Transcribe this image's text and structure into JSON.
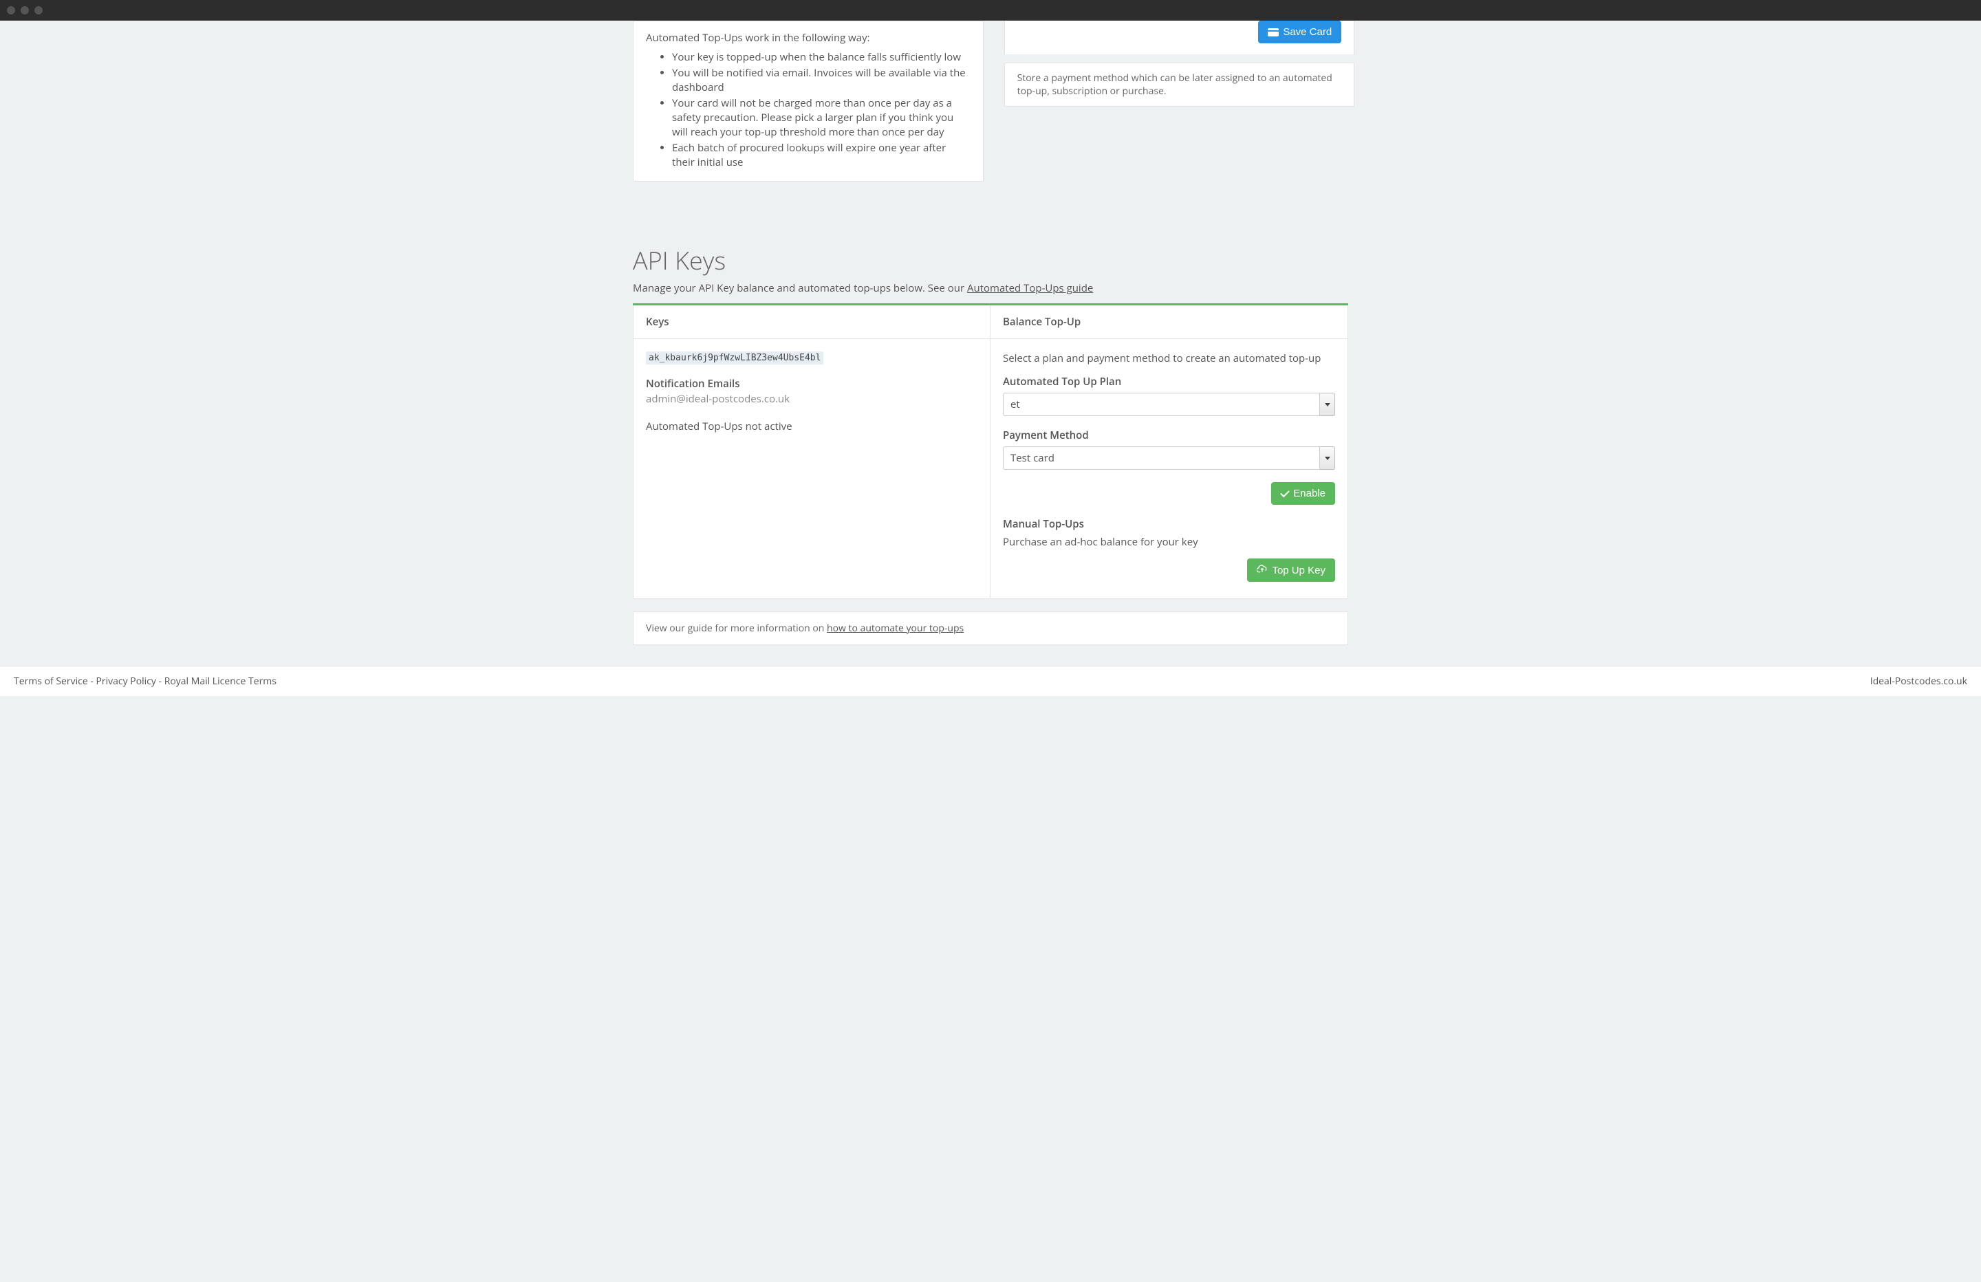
{
  "titlebar": {
    "dots": 3
  },
  "topups_info": {
    "intro": "Automated Top-Ups work in the following way:",
    "bullets": [
      "Your key is topped-up when the balance falls sufficiently low",
      "You will be notified via email. Invoices will be available via the dashboard",
      "Your card will not be charged more than once per day as a safety precaution. Please pick a larger plan if you think you will reach your top-up threshold more than once per day",
      "Each batch of procured lookups will expire one year after their initial use"
    ]
  },
  "save_card": {
    "button": "Save Card"
  },
  "store_note": "Store a payment method which can be later assigned to an automated top-up, subscription or purchase.",
  "api_keys": {
    "title": "API Keys",
    "subtitle_prefix": "Manage your API Key balance and automated top-ups below. See our ",
    "subtitle_link": "Automated Top-Ups guide",
    "col_keys_header": "Keys",
    "col_balance_header": "Balance Top-Up",
    "key_value": "ak_kbaurk6j9pfWzwLIBZ3ew4UbsE4bl",
    "notif_heading": "Notification Emails",
    "notif_email": "admin@ideal-postcodes.co.uk",
    "topup_status": "Automated Top-Ups not active",
    "right_desc": "Select a plan and payment method to create an automated top-up",
    "plan_label": "Automated Top Up Plan",
    "plan_value": "et",
    "payment_label": "Payment Method",
    "payment_value": "Test card",
    "enable_btn": "Enable",
    "manual_heading": "Manual Top-Ups",
    "manual_desc": "Purchase an ad-hoc balance for your key",
    "topup_btn": "Top Up Key"
  },
  "panel_footer": {
    "prefix": "View our guide for more information on ",
    "link": "how to automate your top-ups"
  },
  "footer": {
    "terms": "Terms of Service",
    "privacy": "Privacy Policy",
    "royal": "Royal Mail Licence Terms",
    "sep": " - ",
    "brand": "Ideal-Postcodes.co.uk"
  }
}
